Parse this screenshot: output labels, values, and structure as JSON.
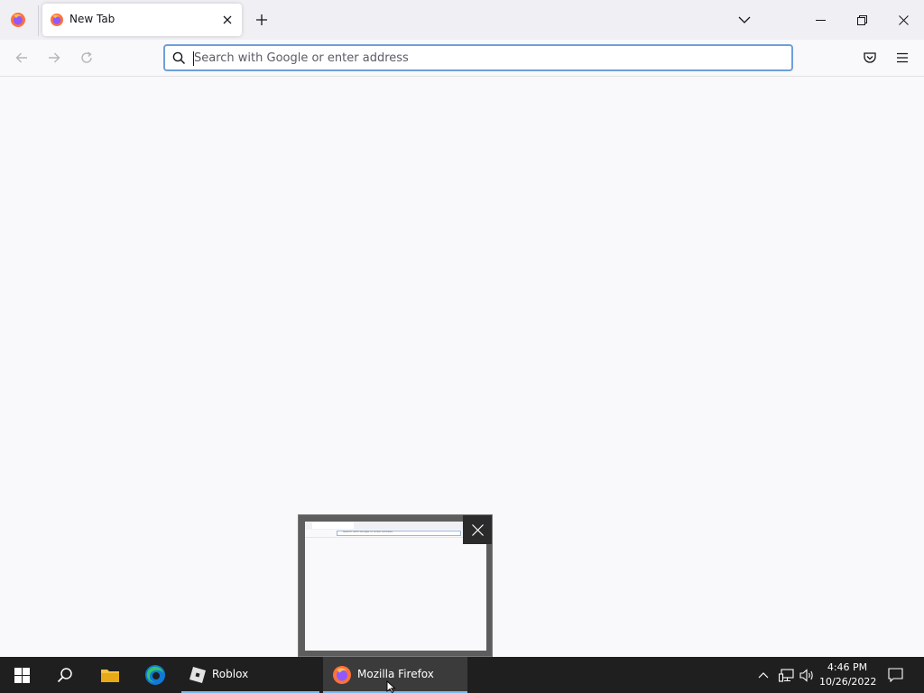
{
  "browser": {
    "tab": {
      "title": "New Tab"
    },
    "urlbar": {
      "placeholder": "Search with Google or enter address",
      "value": ""
    },
    "icons": {
      "app_menu": "firefox-logo-icon",
      "tab_close": "close-icon",
      "new_tab": "plus-icon",
      "list_tabs": "chevron-down-icon",
      "back": "back-arrow-icon",
      "forward": "forward-arrow-icon",
      "reload": "reload-icon",
      "search": "search-icon",
      "pocket": "pocket-icon",
      "menu": "hamburger-menu-icon"
    },
    "window_controls": [
      "minimize-icon",
      "restore-icon",
      "close-icon"
    ]
  },
  "thumbnail_preview": {
    "mini_url_text": "Search with Google or enter address"
  },
  "taskbar": {
    "apps": [
      {
        "label": "Roblox",
        "active": false
      },
      {
        "label": "Mozilla Firefox",
        "active": true
      }
    ],
    "pinned_icons": [
      "windows-start-icon",
      "search-icon",
      "file-explorer-icon",
      "edge-icon"
    ],
    "tray_icons": [
      "show-hidden-icons-chevron-icon",
      "network-icon",
      "volume-icon",
      "action-center-icon"
    ],
    "clock": {
      "time": "4:46 PM",
      "date": "10/26/2022"
    }
  },
  "colors": {
    "accent": "#0061e0",
    "focus_ring": "#6f9fd8",
    "taskbar": "#1f1f1f",
    "taskbar_active_underline": "#76b9ed"
  }
}
